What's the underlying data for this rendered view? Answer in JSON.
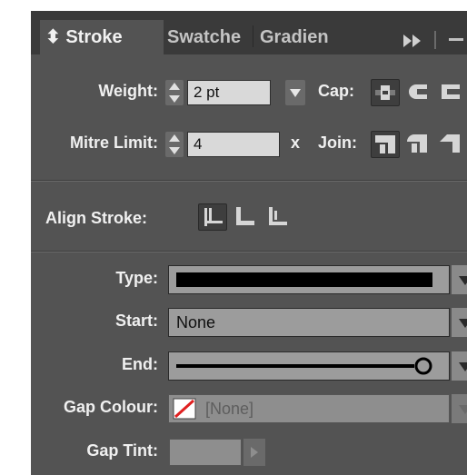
{
  "tabs": [
    {
      "label": "⬍ Stroke",
      "active": true
    },
    {
      "label": "Swatche",
      "active": false
    },
    {
      "label": "Gradien",
      "active": false
    }
  ],
  "tabbar_icons": [
    "fast-forward-icon",
    "grip-icon",
    "menu-icon"
  ],
  "weight": {
    "label": "Weight:",
    "value": "2 pt"
  },
  "cap": {
    "label": "Cap:",
    "options": [
      "butt-cap-icon",
      "round-cap-icon",
      "projecting-cap-icon"
    ],
    "selected": 0
  },
  "mitre": {
    "label": "Mitre Limit:",
    "value": "4",
    "unit": "x"
  },
  "join": {
    "label": "Join:",
    "options": [
      "miter-join-icon",
      "round-join-icon",
      "bevel-join-icon"
    ],
    "selected": 0
  },
  "align": {
    "label": "Align Stroke:",
    "options": [
      "align-center-icon",
      "align-inside-icon",
      "align-outside-icon"
    ],
    "selected": 0
  },
  "type": {
    "label": "Type:"
  },
  "start": {
    "label": "Start:",
    "value": "None"
  },
  "end": {
    "label": "End:"
  },
  "gap_colour": {
    "label": "Gap Colour:",
    "value": "[None]"
  },
  "gap_tint": {
    "label": "Gap Tint:"
  },
  "colors": {
    "panel": "#535353",
    "tabbar": "#3a3a3a",
    "swatch_none": "#e02020"
  }
}
